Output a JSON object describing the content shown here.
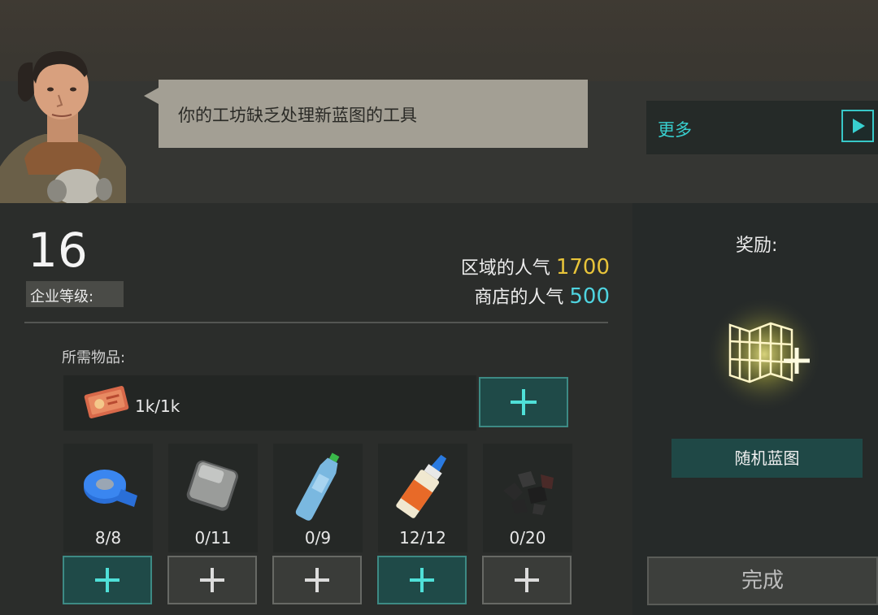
{
  "dialog": {
    "message": "你的工坊缺乏处理新蓝图的工具",
    "more_label": "更多"
  },
  "company": {
    "level": "16",
    "level_label": "企业等级:"
  },
  "popularity": {
    "district_label": "区域的人气",
    "district_value": "1700",
    "shop_label": "商店的人气",
    "shop_value": "500"
  },
  "required": {
    "label": "所需物品:",
    "currency_amount": "1k/1k",
    "items": [
      {
        "icon": "duct-tape-icon",
        "count": "8/8",
        "complete": true
      },
      {
        "icon": "metal-plate-icon",
        "count": "0/11",
        "complete": false
      },
      {
        "icon": "plastic-bottle-icon",
        "count": "0/9",
        "complete": false
      },
      {
        "icon": "glue-tube-icon",
        "count": "12/12",
        "complete": true
      },
      {
        "icon": "coal-icon",
        "count": "0/20",
        "complete": false
      }
    ]
  },
  "reward": {
    "title": "奖励:",
    "item_label": "随机蓝图"
  },
  "done_button": "完成",
  "colors": {
    "teal_accent": "#38d0d0",
    "district_popularity": "#e8c43a",
    "shop_popularity": "#4fd4e0",
    "speech_bubble": "#a39f94"
  }
}
